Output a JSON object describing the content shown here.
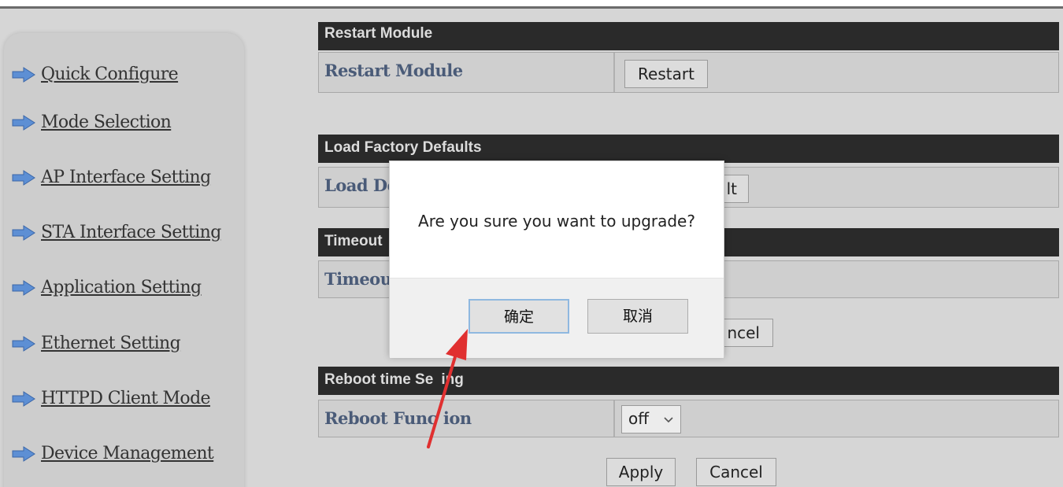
{
  "sidebar": {
    "items": [
      {
        "label": "Quick Configure"
      },
      {
        "label": "Mode Selection"
      },
      {
        "label": "AP Interface Setting"
      },
      {
        "label": "STA Interface Setting"
      },
      {
        "label": "Application Setting"
      },
      {
        "label": "Ethernet Setting"
      },
      {
        "label": "HTTPD Client Mode"
      },
      {
        "label": "Device Management"
      }
    ]
  },
  "sections": {
    "restart": {
      "header": "Restart Module",
      "row_label": "Restart Module",
      "button": "Restart"
    },
    "factory": {
      "header": "Load Factory Defaults",
      "row_label": "Load De",
      "button": "lt"
    },
    "timeout": {
      "header": "Timeout",
      "row_label": "Timeou",
      "cancel_button": "ncel"
    },
    "reboot": {
      "header": "Reboot time Se",
      "header_tail": "ing",
      "row_label": "Reboot Func",
      "row_label_tail": "ion",
      "select_value": "off",
      "apply_button": "Apply",
      "cancel_button": "Cancel"
    }
  },
  "dialog": {
    "message": "Are you sure you want to upgrade?",
    "ok_label": "确定",
    "cancel_label": "取消"
  },
  "colors": {
    "annotation_arrow": "#e03030",
    "section_header_bg": "#2a2a2a",
    "row_label_text": "#4a5b78"
  }
}
